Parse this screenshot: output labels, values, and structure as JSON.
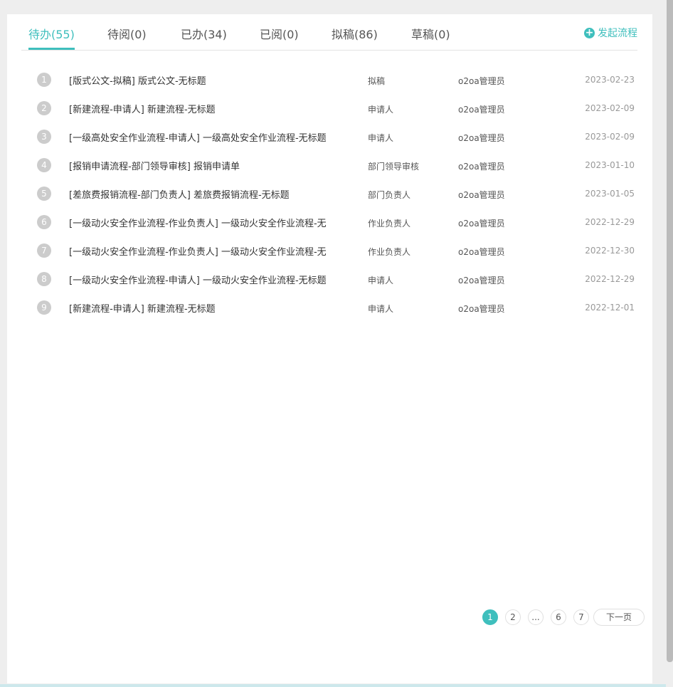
{
  "tabs": [
    {
      "label": "待办(55)"
    },
    {
      "label": "待阅(0)"
    },
    {
      "label": "已办(34)"
    },
    {
      "label": "已阅(0)"
    },
    {
      "label": "拟稿(86)"
    },
    {
      "label": "草稿(0)"
    }
  ],
  "start_process": "发起流程",
  "accent": "#3fbfbd",
  "rows": [
    {
      "n": "1",
      "title": "[版式公文-拟稿] 版式公文-无标题",
      "activity": "拟稿",
      "person": "o2oa管理员",
      "date": "2023-02-23"
    },
    {
      "n": "2",
      "title": "[新建流程-申请人] 新建流程-无标题",
      "activity": "申请人",
      "person": "o2oa管理员",
      "date": "2023-02-09"
    },
    {
      "n": "3",
      "title": "[一级高处安全作业流程-申请人] 一级高处安全作业流程-无标题",
      "activity": "申请人",
      "person": "o2oa管理员",
      "date": "2023-02-09"
    },
    {
      "n": "4",
      "title": "[报销申请流程-部门领导审核] 报销申请单",
      "activity": "部门领导审核",
      "person": "o2oa管理员",
      "date": "2023-01-10"
    },
    {
      "n": "5",
      "title": "[差旅费报销流程-部门负责人] 差旅费报销流程-无标题",
      "activity": "部门负责人",
      "person": "o2oa管理员",
      "date": "2023-01-05"
    },
    {
      "n": "6",
      "title": "[一级动火安全作业流程-作业负责人] 一级动火安全作业流程-无",
      "activity": "作业负责人",
      "person": "o2oa管理员",
      "date": "2022-12-29"
    },
    {
      "n": "7",
      "title": "[一级动火安全作业流程-作业负责人] 一级动火安全作业流程-无",
      "activity": "作业负责人",
      "person": "o2oa管理员",
      "date": "2022-12-30"
    },
    {
      "n": "8",
      "title": "[一级动火安全作业流程-申请人] 一级动火安全作业流程-无标题",
      "activity": "申请人",
      "person": "o2oa管理员",
      "date": "2022-12-29"
    },
    {
      "n": "9",
      "title": "[新建流程-申请人] 新建流程-无标题",
      "activity": "申请人",
      "person": "o2oa管理员",
      "date": "2022-12-01"
    }
  ],
  "pagination": {
    "pages": [
      "1",
      "2",
      "...",
      "6",
      "7"
    ],
    "next": "下一页"
  }
}
